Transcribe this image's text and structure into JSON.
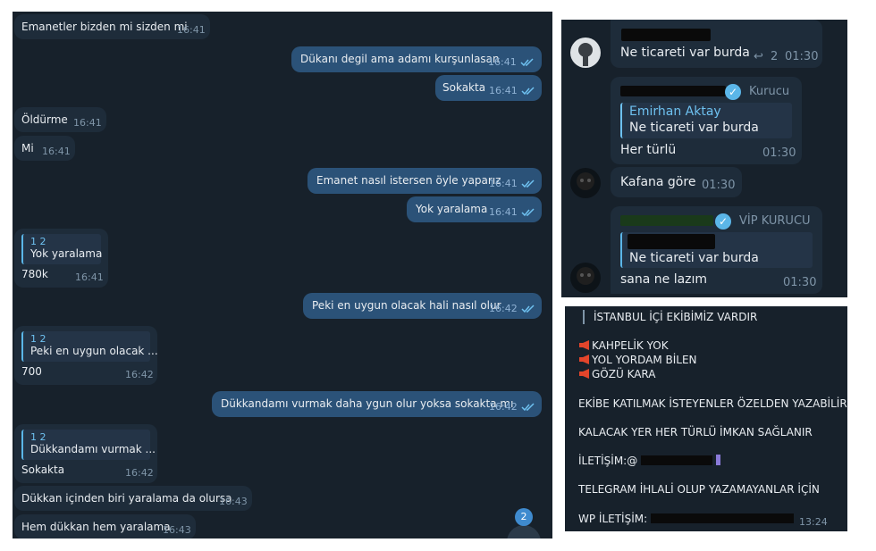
{
  "left": {
    "messages": [
      {
        "text": "Emanetler bizden mi sizden mi",
        "time": "16:41",
        "dir": "in"
      },
      {
        "text": "Dükanı degil ama adamı kurşunlasan",
        "time": "16:41",
        "dir": "out"
      },
      {
        "text": "Sokakta",
        "time": "16:41",
        "dir": "out"
      },
      {
        "text": "Öldürme",
        "time": "16:41",
        "dir": "in"
      },
      {
        "text": "Mi",
        "time": "16:41",
        "dir": "in"
      },
      {
        "text": "Emanet nasıl istersen öyle yaparız",
        "time": "16:41",
        "dir": "out"
      },
      {
        "text": "Yok yaralama",
        "time": "16:41",
        "dir": "out"
      },
      {
        "quote_name": "1 2",
        "quote_text": "Yok yaralama",
        "text": "780k",
        "time": "16:41",
        "dir": "in"
      },
      {
        "text": "Peki en uygun olacak hali nasıl olur",
        "time": "16:42",
        "dir": "out"
      },
      {
        "quote_name": "1 2",
        "quote_text": "Peki en uygun olacak ...",
        "text": "700",
        "time": "16:42",
        "dir": "in"
      },
      {
        "text": "Dükkandamı vurmak daha ygun olur yoksa sokakta mı",
        "time": "16:42",
        "dir": "out"
      },
      {
        "quote_name": "1 2",
        "quote_text": "Dükkandamı vurmak ...",
        "text": "Sokakta",
        "time": "16:42",
        "dir": "in"
      },
      {
        "text": "Dükkan içinden biri yaralama da olursa",
        "time": "16:43",
        "dir": "in"
      },
      {
        "text": "Hem dükkan hem yaralama",
        "time": "16:43",
        "dir": "in"
      }
    ],
    "unread_badge": "2"
  },
  "top_right": {
    "msg1": {
      "text": "Ne ticareti var burda",
      "replies": "2",
      "time": "01:30"
    },
    "msg2": {
      "role": "Kurucu",
      "quote_name": "Emirhan Aktay",
      "quote_text": "Ne ticareti var burda",
      "text": "Her türlü",
      "time": "01:30"
    },
    "msg3": {
      "text": "Kafana göre",
      "time": "01:30"
    },
    "msg4": {
      "role": "VİP KURUCU",
      "quote_text": "Ne ticareti var burda",
      "text": "sana ne lazım",
      "time": "01:30"
    }
  },
  "bottom_right": {
    "line1": "İSTANBUL İÇİ EKİBİMİZ VARDIR",
    "bullets": [
      "KAHPELİK YOK",
      "YOL YORDAM BİLEN",
      "GÖZÜ KARA"
    ],
    "line2": "EKİBE KATILMAK İSTEYENLER ÖZELDEN YAZABİLİR",
    "line3": "KALACAK YER HER TÜRLÜ İMKAN SAĞLANIR",
    "contact_label": "İLETİŞİM:@",
    "line4": "TELEGRAM İHLALİ OLUP YAZAMAYANLAR İÇİN",
    "wp_label": "WP İLETİŞİM:",
    "time": "13:24"
  },
  "colors": {
    "incoming": "#1e2c3a",
    "outgoing": "#2b5278",
    "background": "#17212b",
    "accent": "#5bb6e8"
  }
}
